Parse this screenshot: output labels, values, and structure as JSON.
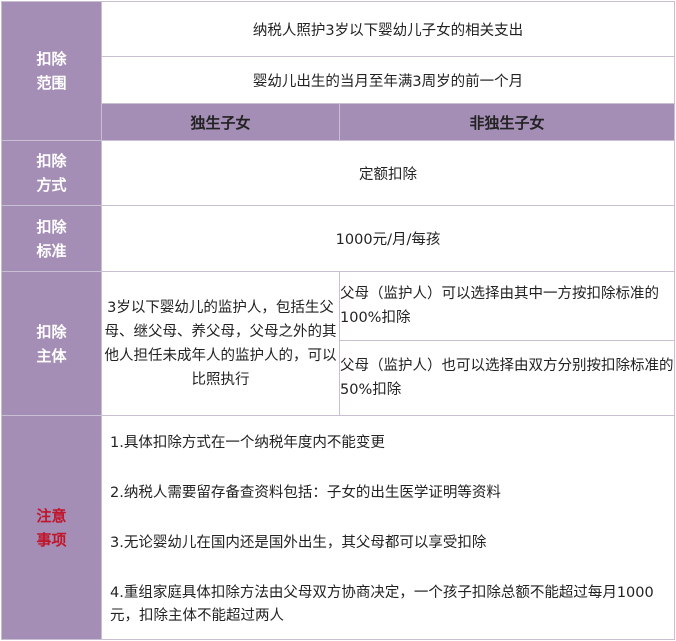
{
  "rows": {
    "scope": {
      "label_line1": "扣除",
      "label_line2": "范围",
      "content1": "纳税人照护3岁以下婴幼儿子女的相关支出",
      "content2": "婴幼儿出生的当月至年满3周岁的前一个月"
    },
    "headers": {
      "only_child": "独生子女",
      "non_only_child": "非独生子女"
    },
    "method": {
      "label_line1": "扣除",
      "label_line2": "方式",
      "content": "定额扣除"
    },
    "standard": {
      "label_line1": "扣除",
      "label_line2": "标准",
      "content": "1000元/月/每孩"
    },
    "subject": {
      "label_line1": "扣除",
      "label_line2": "主体",
      "left": "3岁以下婴幼儿的监护人，包括生父母、继父母、养父母，父母之外的其他人担任未成年人的监护人的，可以比照执行",
      "right1": "父母（监护人）可以选择由其中一方按扣除标准的100%扣除",
      "right2": "父母（监护人）也可以选择由双方分别按扣除标准的50%扣除"
    },
    "notes": {
      "label_line1": "注意",
      "label_line2": "事项",
      "items": [
        "1.具体扣除方式在一个纳税年度内不能变更",
        "2.纳税人需要留存备查资料包括：子女的出生医学证明等资料",
        "3.无论婴幼儿在国内还是国外出生，其父母都可以享受扣除",
        "4.重组家庭具体扣除方法由父母双方协商决定，一个孩子扣除总额不能超过每月1000元，扣除主体不能超过两人"
      ]
    }
  },
  "colors": {
    "header_bg": "#a48eb5",
    "border": "#c9bfd3",
    "label_text": "#ffffff",
    "warning_label_text": "#c0152a"
  }
}
